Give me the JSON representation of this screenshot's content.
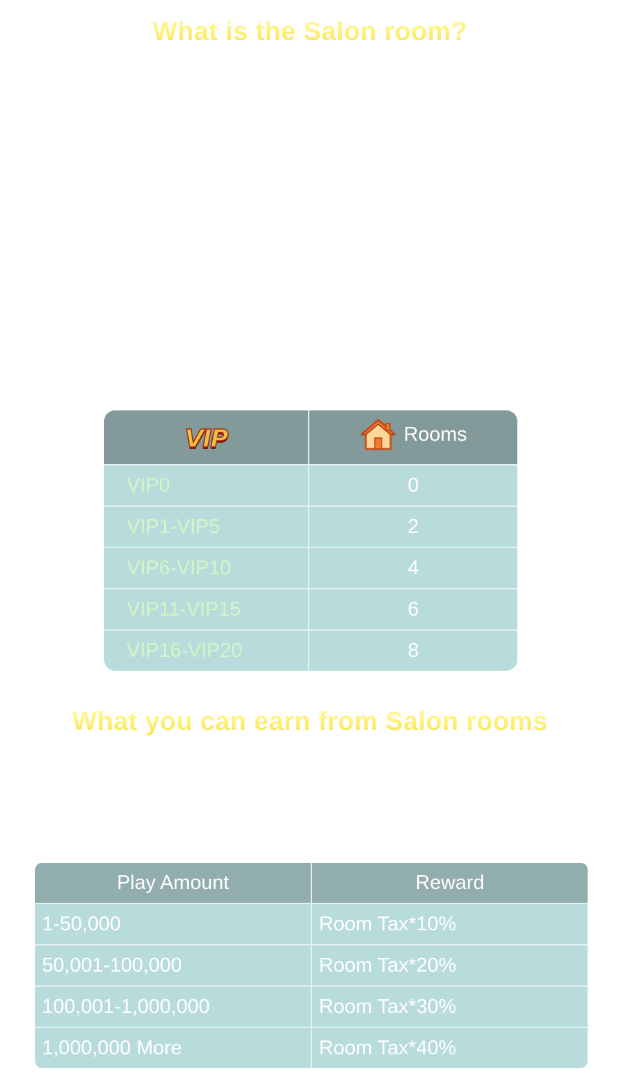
{
  "headings": {
    "salon": "What is the Salon room?",
    "earn": "What you can earn from Salon rooms"
  },
  "vip_table": {
    "header": {
      "vip_logo_text": "VIP",
      "rooms_label": "Rooms",
      "rooms_icon": "house-icon"
    },
    "rows": [
      {
        "level": "VIP0",
        "rooms": "0"
      },
      {
        "level": "VIP1-VIP5",
        "rooms": "2"
      },
      {
        "level": "VIP6-VIP10",
        "rooms": "4"
      },
      {
        "level": "VIP11-VIP15",
        "rooms": "6"
      },
      {
        "level": "VIP16-VIP20",
        "rooms": "8"
      }
    ]
  },
  "reward_table": {
    "header": {
      "amount": "Play Amount",
      "reward": "Reward"
    },
    "rows": [
      {
        "amount": "1-50,000",
        "reward": "Room Tax*10%"
      },
      {
        "amount": "50,001-100,000",
        "reward": "Room Tax*20%"
      },
      {
        "amount": "100,001-1,000,000",
        "reward": "Room Tax*30%"
      },
      {
        "amount": "1,000,000 More",
        "reward": "Room Tax*40%"
      }
    ]
  },
  "colors": {
    "heading_gradient": [
      "#fff9b8",
      "#f6e15a"
    ],
    "table_header_vip": "#829a99",
    "table_header_reward": "#92adad",
    "table_body": "#b8dcdb",
    "vip_level_text": "#d5f6c4",
    "row_divider": "#e3f1f1"
  }
}
